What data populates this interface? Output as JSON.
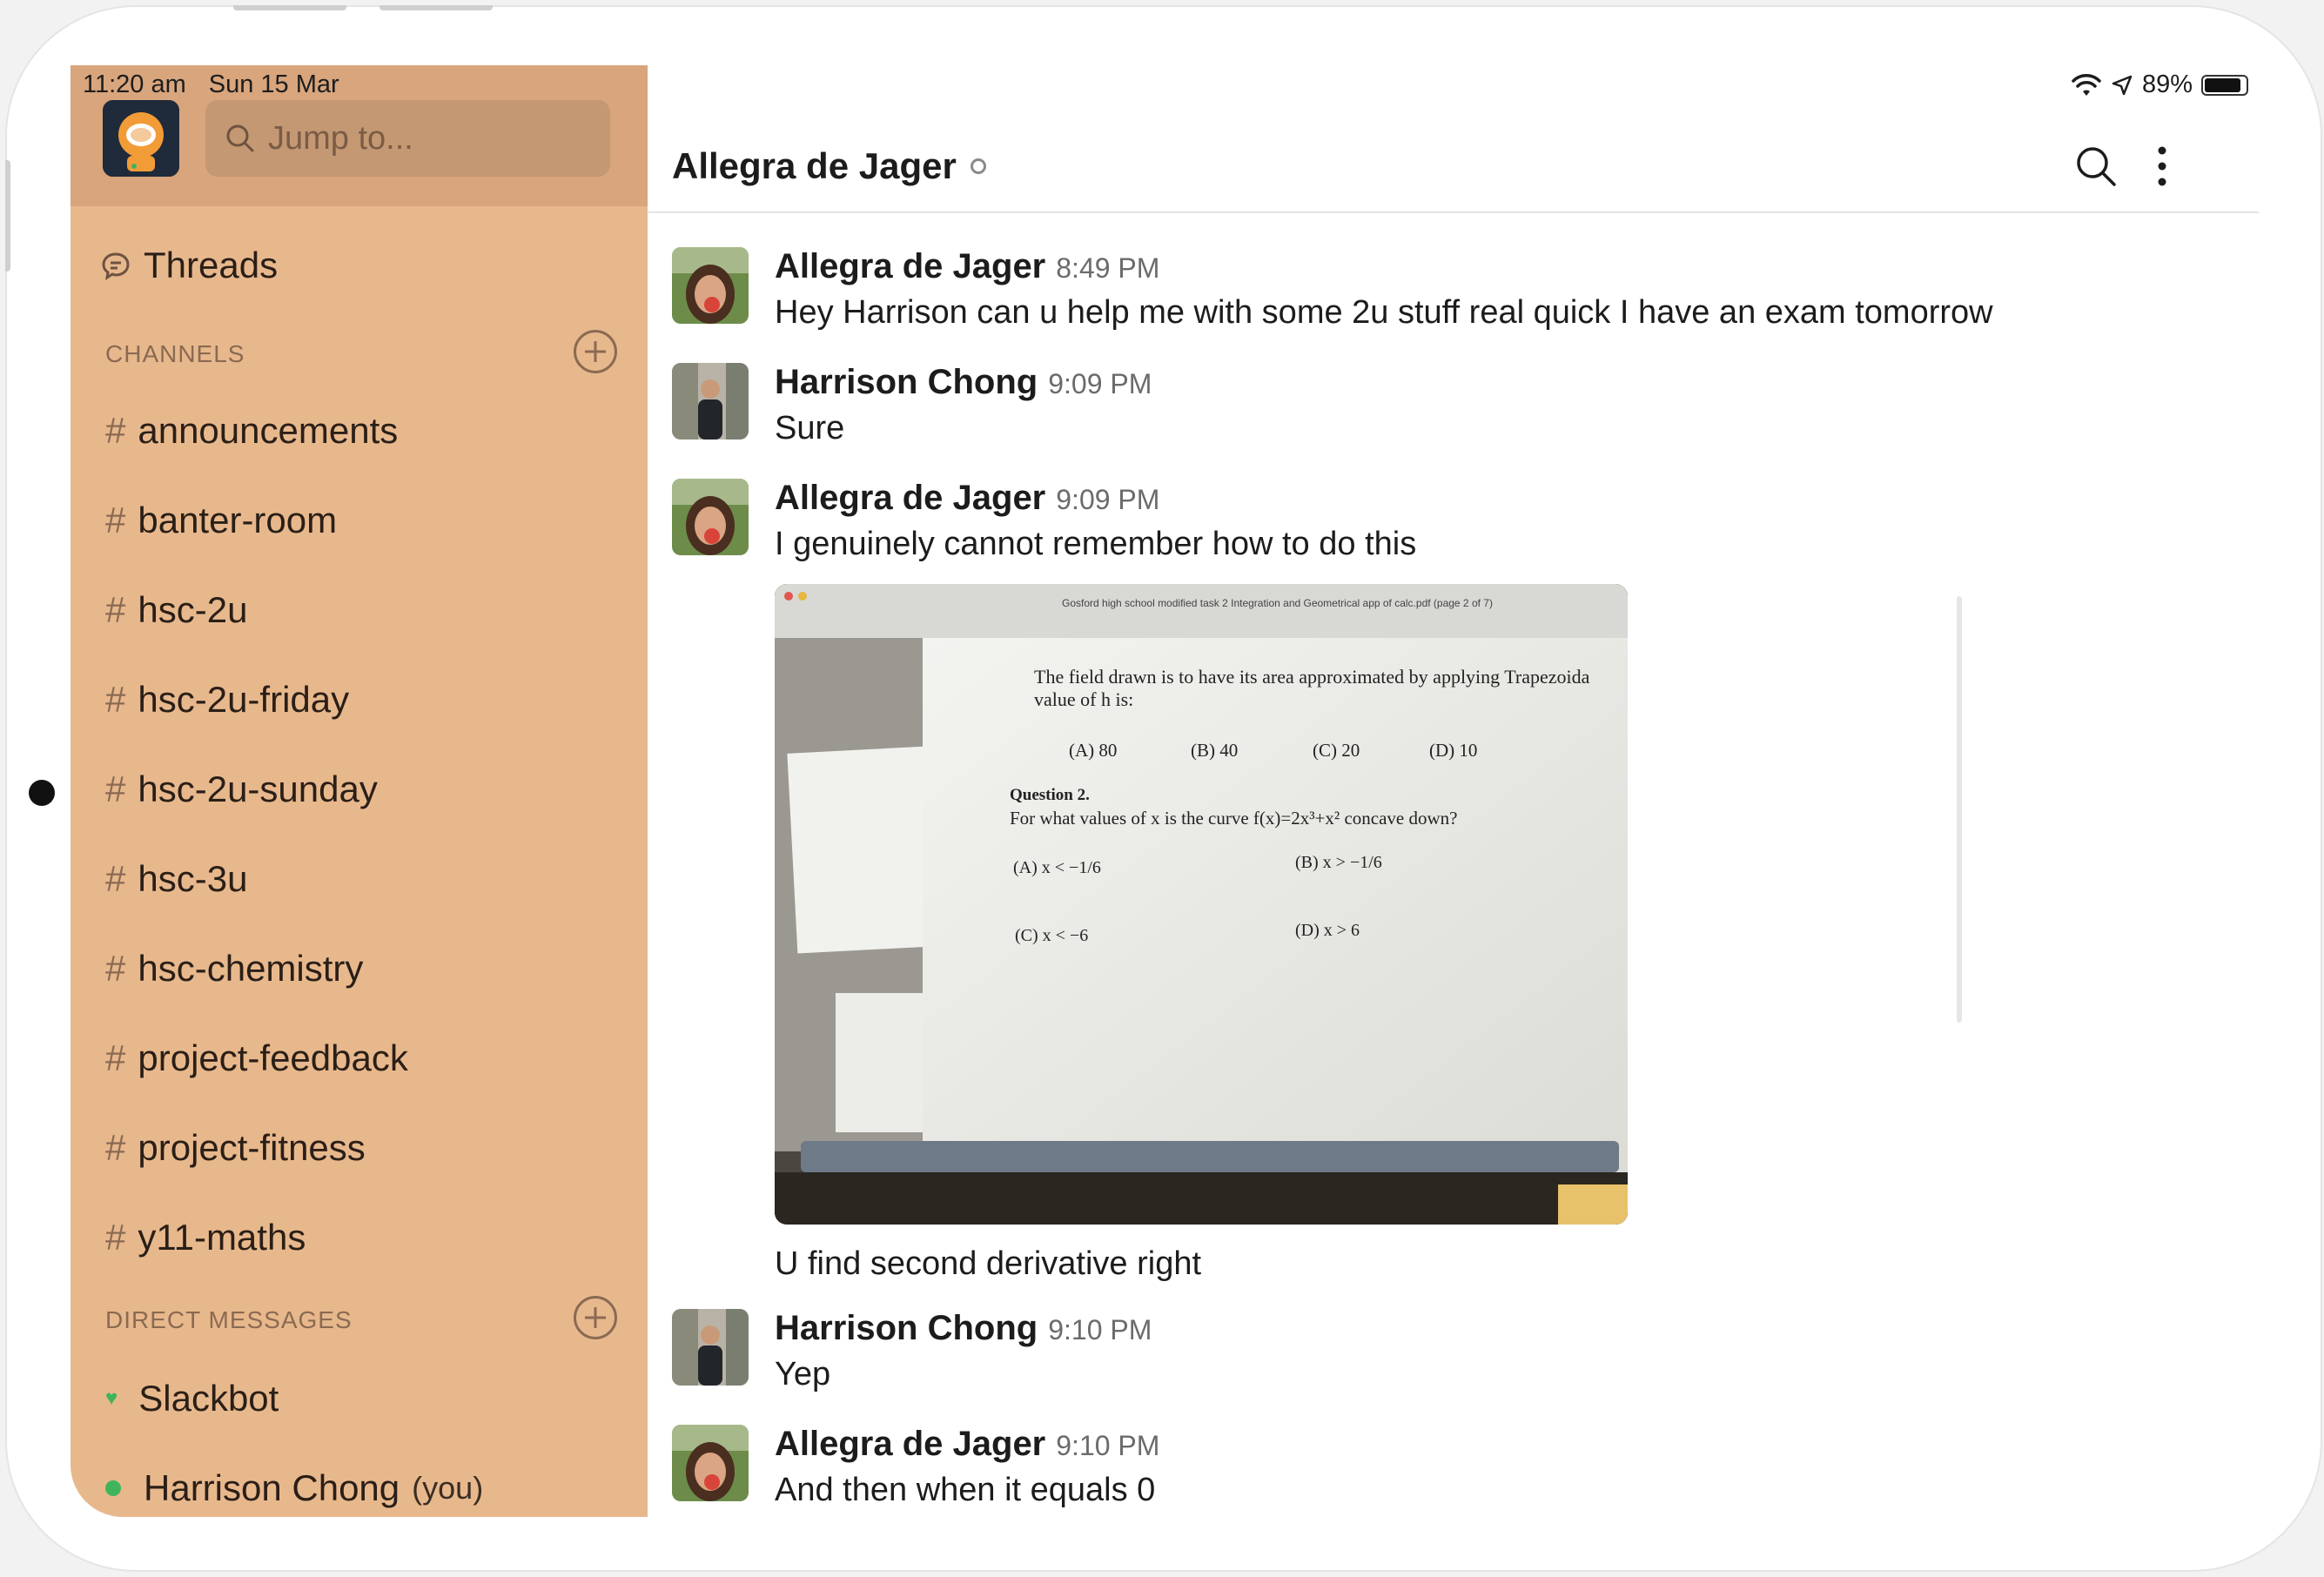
{
  "status_bar": {
    "time": "11:20 am",
    "date": "Sun 15 Mar",
    "battery": "89%",
    "battery_level": 0.89
  },
  "search": {
    "placeholder": "Jump to..."
  },
  "sidebar": {
    "threads_label": "Threads",
    "channels_header": "CHANNELS",
    "channels": [
      "announcements",
      "banter-room",
      "hsc-2u",
      "hsc-2u-friday",
      "hsc-2u-sunday",
      "hsc-3u",
      "hsc-chemistry",
      "project-feedback",
      "project-fitness",
      "y11-maths"
    ],
    "hash": "#",
    "dm_header": "DIRECT MESSAGES",
    "dms": [
      {
        "name": "Slackbot"
      },
      {
        "name": "Harrison Chong",
        "suffix": "(you)"
      }
    ]
  },
  "header": {
    "title": "Allegra de Jager"
  },
  "messages": [
    {
      "sender": "Allegra de Jager",
      "time": "8:49 PM",
      "text": "Hey Harrison can u help me with some 2u stuff real quick I have an exam tomorrow"
    },
    {
      "sender": "Harrison Chong",
      "time": "9:09 PM",
      "text": "Sure"
    },
    {
      "sender": "Allegra de Jager",
      "time": "9:09 PM",
      "text": "I genuinely cannot remember how to do this"
    },
    {
      "text": "U find second derivative right"
    },
    {
      "sender": "Harrison Chong",
      "time": "9:10 PM",
      "text": "Yep"
    },
    {
      "sender": "Allegra de Jager",
      "time": "9:10 PM",
      "text": "And then when it equals 0"
    }
  ],
  "photo": {
    "window_title": "Gosford high school modified task 2 Integration and Geometrical app of calc.pdf (page 2 of 7)",
    "prev_question": "The field drawn is to have its area approximated by applying Trapezoida",
    "prev_question_2": "value of h is:",
    "options": [
      "(A) 80",
      "(B) 40",
      "(C) 20",
      "(D) 10"
    ],
    "q2_label": "Question 2.",
    "q2_text": "For what values of x is the curve f(x)=2x³+x² concave down?",
    "q2_options": [
      "(A)  x < −1/6",
      "(B)  x > −1/6",
      "(C)  x < −6",
      "(D)  x > 6"
    ]
  }
}
